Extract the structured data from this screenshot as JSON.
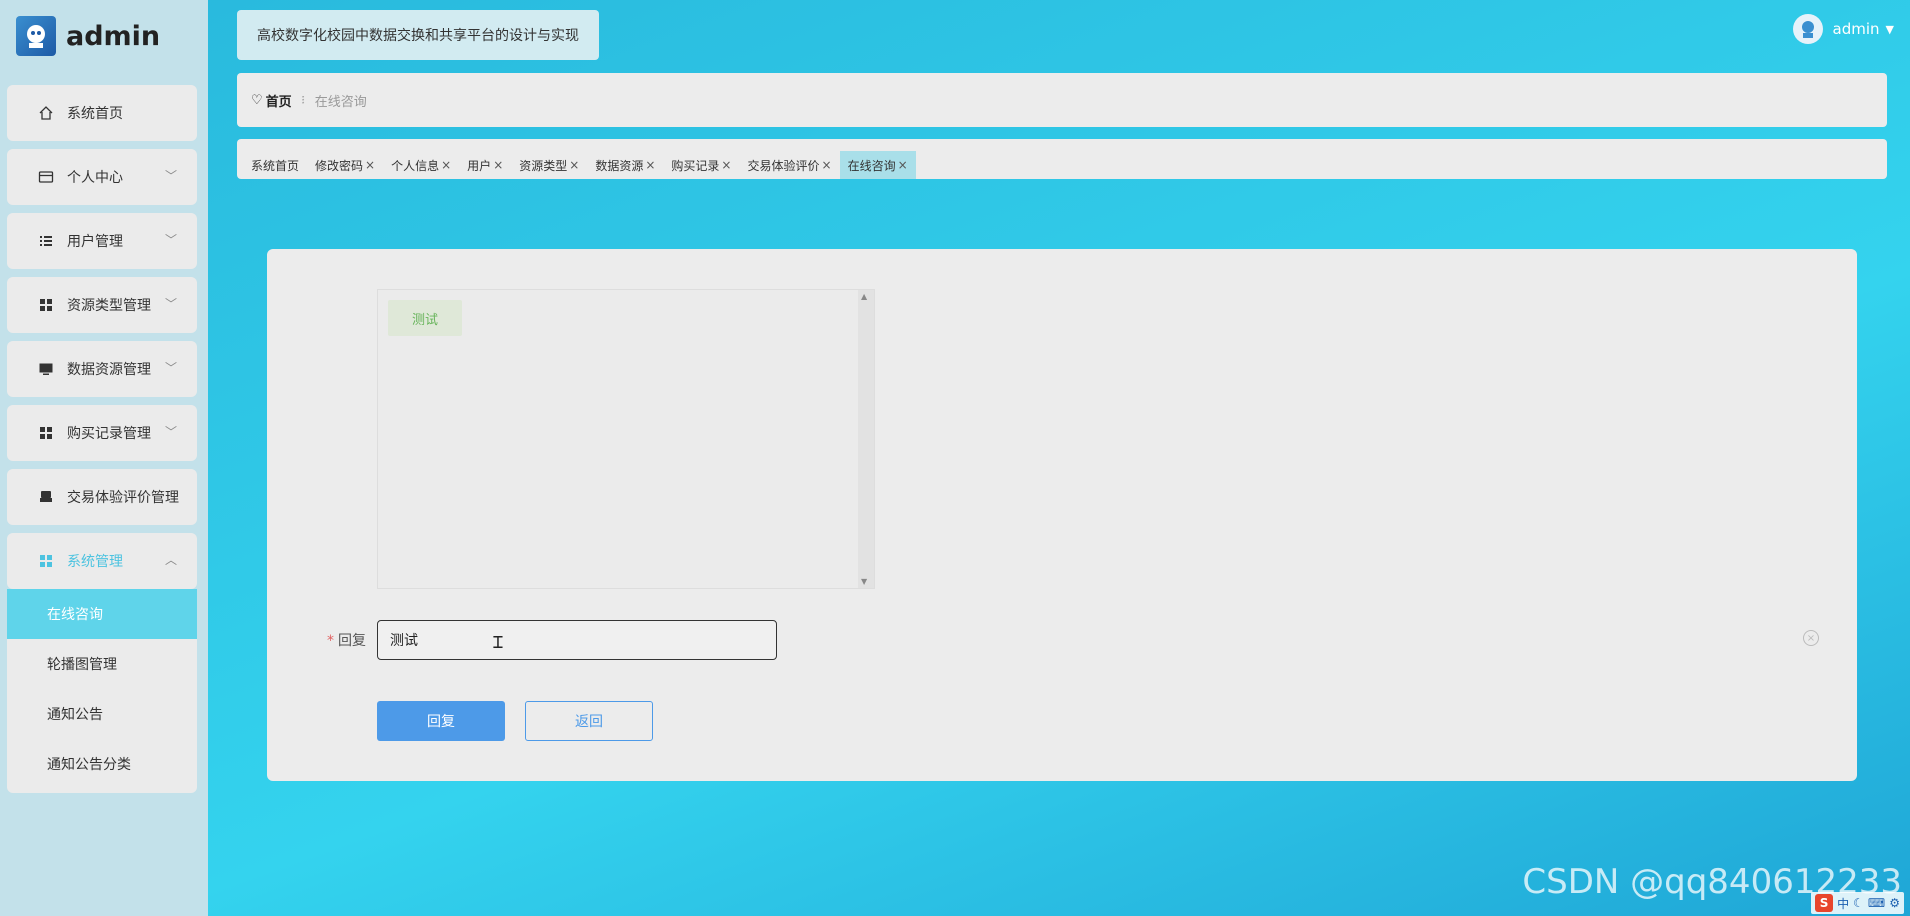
{
  "app": {
    "logo_text": "admin",
    "system_title": "高校数字化校园中数据交换和共享平台的设计与实现",
    "user_name": "admin"
  },
  "sidebar": {
    "items": [
      {
        "label": "系统首页",
        "icon": "home-icon"
      },
      {
        "label": "个人中心",
        "icon": "card-icon"
      },
      {
        "label": "用户管理",
        "icon": "list-icon"
      },
      {
        "label": "资源类型管理",
        "icon": "grid-icon"
      },
      {
        "label": "数据资源管理",
        "icon": "monitor-icon"
      },
      {
        "label": "购买记录管理",
        "icon": "grid-icon"
      },
      {
        "label": "交易体验评价管理",
        "icon": "printer-icon"
      },
      {
        "label": "系统管理",
        "icon": "grid-icon"
      }
    ],
    "sub_items": [
      "在线咨询",
      "轮播图管理",
      "通知公告",
      "通知公告分类"
    ]
  },
  "breadcrumb": {
    "home": "首页",
    "separator": "፧",
    "current": "在线咨询"
  },
  "tabs": [
    "系统首页",
    "修改密码",
    "个人信息",
    "用户",
    "资源类型",
    "数据资源",
    "购买记录",
    "交易体验评价",
    "在线咨询"
  ],
  "tab_close": "×",
  "chat": {
    "messages": [
      "测试"
    ]
  },
  "form": {
    "reply_label": "回复",
    "required_mark": "*",
    "reply_value": "测试",
    "reply_button": "回复",
    "back_button": "返回"
  },
  "watermark": "CSDN @qq840612233",
  "ime": {
    "logo": "S",
    "lang": "中"
  },
  "colors": {
    "accent": "#4d9ae8",
    "active_menu": "#5fd4ea",
    "chat_text": "#67b45a"
  }
}
